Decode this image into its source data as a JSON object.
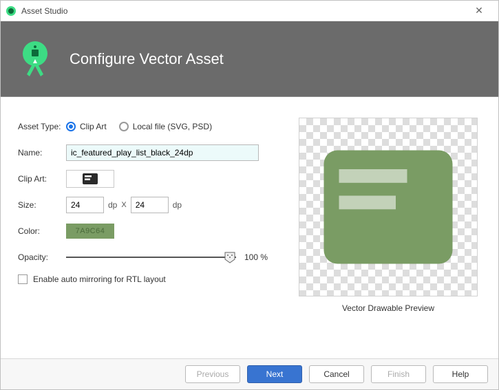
{
  "window": {
    "title": "Asset Studio"
  },
  "header": {
    "title": "Configure Vector Asset"
  },
  "form": {
    "assetTypeLabel": "Asset Type:",
    "assetType": {
      "options": [
        {
          "label": "Clip Art",
          "selected": true
        },
        {
          "label": "Local file (SVG, PSD)",
          "selected": false
        }
      ]
    },
    "nameLabel": "Name:",
    "nameValue": "ic_featured_play_list_black_24dp",
    "clipArtLabel": "Clip Art:",
    "sizeLabel": "Size:",
    "size": {
      "width": "24",
      "height": "24",
      "unit": "dp",
      "separator": "X"
    },
    "colorLabel": "Color:",
    "colorHex": "7A9C64",
    "opacityLabel": "Opacity:",
    "opacityValue": "100 %",
    "mirrorLabel": "Enable auto mirroring for RTL layout"
  },
  "preview": {
    "label": "Vector Drawable Preview"
  },
  "footer": {
    "previous": "Previous",
    "next": "Next",
    "cancel": "Cancel",
    "finish": "Finish",
    "help": "Help"
  }
}
